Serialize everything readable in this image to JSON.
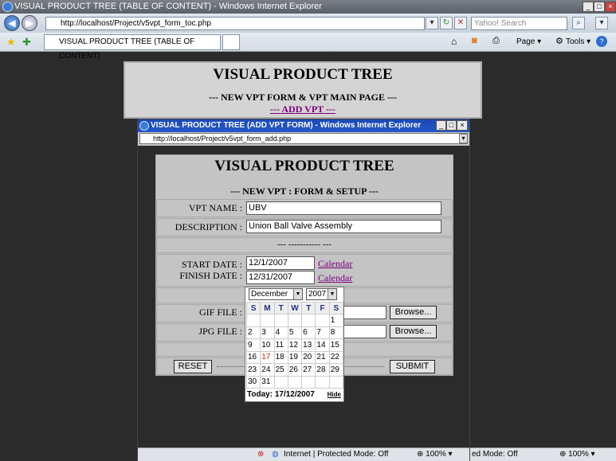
{
  "browser": {
    "title": "VISUAL PRODUCT TREE (TABLE OF CONTENT) - Windows Internet Explorer",
    "address": "http://localhost/Project/v5vpt_form_toc.php",
    "search_placeholder": "Yahoo! Search",
    "tab_label": "VISUAL PRODUCT TREE (TABLE OF CONTENT)",
    "page_label": "Page",
    "tools_label": "Tools",
    "status_mode": "Internet | Protected Mode: Off",
    "status_mode_short": "ed Mode: Off",
    "zoom": "100%"
  },
  "main_page": {
    "title": "VISUAL PRODUCT TREE",
    "subtitle": "--- NEW VPT FORM & VPT MAIN PAGE ---",
    "add_link": "--- ADD VPT ---"
  },
  "popup": {
    "title": "VISUAL PRODUCT TREE (ADD VPT FORM) - Windows Internet Explorer",
    "address": "http://localhost/Project/v5vpt_form_add.php",
    "status_mode": "Internet | Protected Mode: Off",
    "zoom": "100%"
  },
  "form": {
    "title": "VISUAL PRODUCT TREE",
    "subtitle": "--- NEW VPT : FORM & SETUP ---",
    "vpt_name_label": "VPT NAME :",
    "vpt_name_value": "UBV",
    "description_label": "DESCRIPTION :",
    "description_value": "Union Ball Valve Assembly",
    "divider": "--- ----------- ---",
    "start_date_label": "START DATE :",
    "start_date_value": "12/1/2007",
    "finish_date_label": "FINISH DATE :",
    "finish_date_value": "12/31/2007",
    "calendar_link": "Calendar",
    "gif_label": "GIF FILE :",
    "jpg_label": "JPG FILE :",
    "browse_label": "Browse...",
    "reset_label": "RESET",
    "submit_label": "SUBMIT"
  },
  "calendar": {
    "month": "December",
    "year": "2007",
    "weekdays": [
      "S",
      "M",
      "T",
      "W",
      "T",
      "F",
      "S"
    ],
    "weeks": [
      [
        "",
        "",
        "",
        "",
        "",
        "",
        "1"
      ],
      [
        "2",
        "3",
        "4",
        "5",
        "6",
        "7",
        "8"
      ],
      [
        "9",
        "10",
        "11",
        "12",
        "13",
        "14",
        "15"
      ],
      [
        "16",
        "17",
        "18",
        "19",
        "20",
        "21",
        "22"
      ],
      [
        "23",
        "24",
        "25",
        "26",
        "27",
        "28",
        "29"
      ],
      [
        "30",
        "31",
        "",
        "",
        "",
        "",
        ""
      ]
    ],
    "highlight_day": "17",
    "highlight_color": "#d02020",
    "today_label": "Today: 17/12/2007",
    "hide_label": "Hide"
  },
  "colors": {
    "titlebar_active": "#2458c8",
    "link_visited": "#800080",
    "form_bg": "#c4c4c4"
  }
}
